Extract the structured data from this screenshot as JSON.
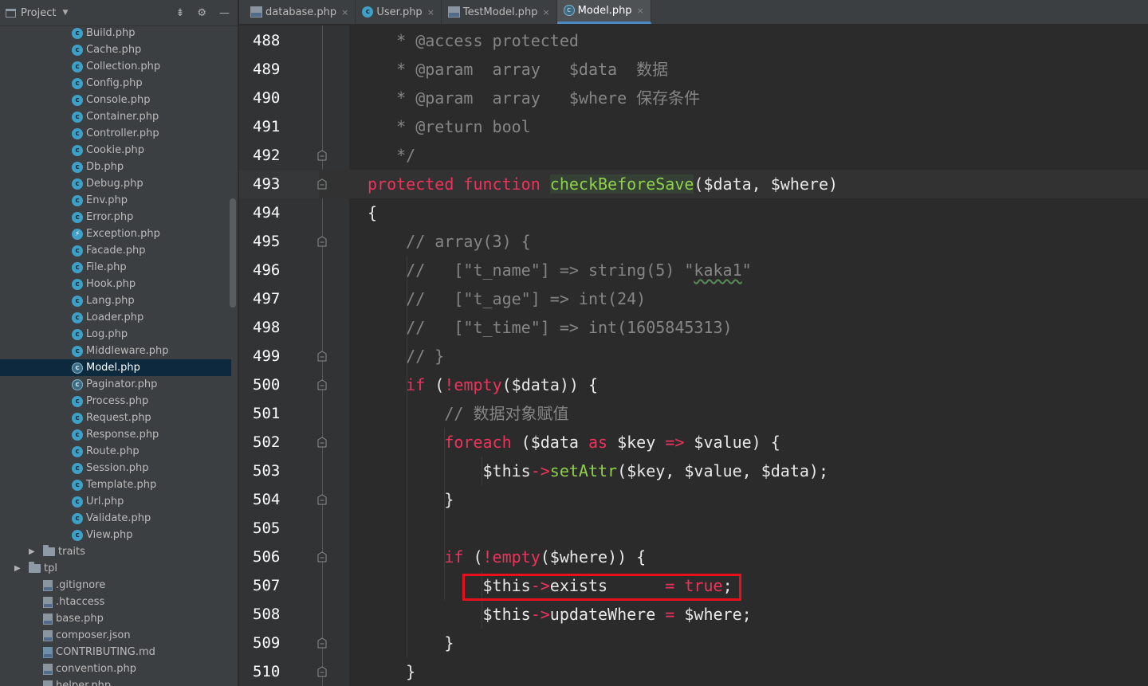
{
  "sidebar": {
    "title": "Project",
    "items": [
      {
        "label": "Build.php",
        "icon": "class-icon",
        "indent": 90
      },
      {
        "label": "Cache.php",
        "icon": "class-icon",
        "indent": 90
      },
      {
        "label": "Collection.php",
        "icon": "class-icon",
        "indent": 90
      },
      {
        "label": "Config.php",
        "icon": "class-icon",
        "indent": 90
      },
      {
        "label": "Console.php",
        "icon": "class-icon",
        "indent": 90
      },
      {
        "label": "Container.php",
        "icon": "class-icon",
        "indent": 90
      },
      {
        "label": "Controller.php",
        "icon": "class-icon",
        "indent": 90
      },
      {
        "label": "Cookie.php",
        "icon": "class-icon",
        "indent": 90
      },
      {
        "label": "Db.php",
        "icon": "class-icon",
        "indent": 90
      },
      {
        "label": "Debug.php",
        "icon": "class-icon",
        "indent": 90
      },
      {
        "label": "Env.php",
        "icon": "class-icon",
        "indent": 90
      },
      {
        "label": "Error.php",
        "icon": "class-icon",
        "indent": 90
      },
      {
        "label": "Exception.php",
        "icon": "exception-class-icon",
        "indent": 90
      },
      {
        "label": "Facade.php",
        "icon": "class-icon",
        "indent": 90
      },
      {
        "label": "File.php",
        "icon": "class-icon",
        "indent": 90
      },
      {
        "label": "Hook.php",
        "icon": "class-icon",
        "indent": 90
      },
      {
        "label": "Lang.php",
        "icon": "class-icon",
        "indent": 90
      },
      {
        "label": "Loader.php",
        "icon": "class-icon",
        "indent": 90
      },
      {
        "label": "Log.php",
        "icon": "class-icon",
        "indent": 90
      },
      {
        "label": "Middleware.php",
        "icon": "class-icon",
        "indent": 90
      },
      {
        "label": "Model.php",
        "icon": "abstract-class-icon",
        "indent": 90,
        "selected": true
      },
      {
        "label": "Paginator.php",
        "icon": "abstract-class-icon",
        "indent": 90
      },
      {
        "label": "Process.php",
        "icon": "class-icon",
        "indent": 90
      },
      {
        "label": "Request.php",
        "icon": "class-icon",
        "indent": 90
      },
      {
        "label": "Response.php",
        "icon": "class-icon",
        "indent": 90
      },
      {
        "label": "Route.php",
        "icon": "class-icon",
        "indent": 90
      },
      {
        "label": "Session.php",
        "icon": "class-icon",
        "indent": 90
      },
      {
        "label": "Template.php",
        "icon": "class-icon",
        "indent": 90
      },
      {
        "label": "Url.php",
        "icon": "class-icon",
        "indent": 90
      },
      {
        "label": "Validate.php",
        "icon": "class-icon",
        "indent": 90
      },
      {
        "label": "View.php",
        "icon": "class-icon",
        "indent": 90
      },
      {
        "label": "traits",
        "icon": "folder-icon",
        "indent": 54,
        "arrow": true
      },
      {
        "label": "tpl",
        "icon": "folder-icon",
        "indent": 36,
        "arrow": true
      },
      {
        "label": ".gitignore",
        "icon": "text-file-icon",
        "indent": 54
      },
      {
        "label": ".htaccess",
        "icon": "php-file-icon",
        "indent": 54
      },
      {
        "label": "base.php",
        "icon": "php-file-icon",
        "indent": 54
      },
      {
        "label": "composer.json",
        "icon": "json-file-icon",
        "indent": 54
      },
      {
        "label": "CONTRIBUTING.md",
        "icon": "markdown-file-icon",
        "indent": 54
      },
      {
        "label": "convention.php",
        "icon": "php-file-icon",
        "indent": 54
      },
      {
        "label": "helper.php",
        "icon": "php-file-icon",
        "indent": 54
      }
    ]
  },
  "tabs": [
    {
      "label": "database.php",
      "icon": "php-file-icon"
    },
    {
      "label": "User.php",
      "icon": "class-icon"
    },
    {
      "label": "TestModel.php",
      "icon": "php-file-icon"
    },
    {
      "label": "Model.php",
      "icon": "abstract-class-icon",
      "active": true
    }
  ],
  "tab_close_glyph": "×",
  "colors": {
    "keyword": "#f0325a",
    "function": "#8fd14b",
    "comment": "#858585",
    "highlight_box": "#e8101c",
    "selected_tree": "#0d293e"
  },
  "editor": {
    "current_line": 493,
    "lines": [
      {
        "n": "488",
        "fold": false,
        "tokens": [
          [
            "c",
            "   * @access protected"
          ]
        ]
      },
      {
        "n": "489",
        "fold": false,
        "tokens": [
          [
            "c",
            "   * @param  array   $data  数据"
          ]
        ]
      },
      {
        "n": "490",
        "fold": false,
        "tokens": [
          [
            "c",
            "   * @param  array   $where 保存条件"
          ]
        ]
      },
      {
        "n": "491",
        "fold": false,
        "tokens": [
          [
            "c",
            "   * @return bool"
          ]
        ]
      },
      {
        "n": "492",
        "fold": true,
        "tokens": [
          [
            "c",
            "   */"
          ]
        ]
      },
      {
        "n": "493",
        "fold": true,
        "tokens": [
          [
            "k",
            "protected"
          ],
          [
            "p",
            " "
          ],
          [
            "k",
            "function"
          ],
          [
            "p",
            " "
          ],
          [
            "fh",
            "checkBeforeSave"
          ],
          [
            "p",
            "($data, $where)"
          ]
        ]
      },
      {
        "n": "494",
        "fold": false,
        "tokens": [
          [
            "p",
            "{"
          ]
        ]
      },
      {
        "n": "495",
        "fold": true,
        "tokens": [
          [
            "c",
            "    // array(3) {"
          ]
        ]
      },
      {
        "n": "496",
        "fold": false,
        "tokens": [
          [
            "c",
            "    //   [\"t_name\"] => string(5) \""
          ],
          [
            "ct",
            "kaka1"
          ],
          [
            "c",
            "\""
          ]
        ]
      },
      {
        "n": "497",
        "fold": false,
        "tokens": [
          [
            "c",
            "    //   [\"t_age\"] => int(24)"
          ]
        ]
      },
      {
        "n": "498",
        "fold": false,
        "tokens": [
          [
            "c",
            "    //   [\"t_time\"] => int(1605845313)"
          ]
        ]
      },
      {
        "n": "499",
        "fold": true,
        "tokens": [
          [
            "c",
            "    // }"
          ]
        ]
      },
      {
        "n": "500",
        "fold": true,
        "tokens": [
          [
            "p",
            "    "
          ],
          [
            "k",
            "if"
          ],
          [
            "p",
            " ("
          ],
          [
            "k",
            "!empty"
          ],
          [
            "p",
            "($data)) {"
          ]
        ]
      },
      {
        "n": "501",
        "fold": false,
        "tokens": [
          [
            "c",
            "        // 数据对象赋值"
          ]
        ]
      },
      {
        "n": "502",
        "fold": true,
        "tokens": [
          [
            "p",
            "        "
          ],
          [
            "k",
            "foreach"
          ],
          [
            "p",
            " ($data "
          ],
          [
            "k",
            "as"
          ],
          [
            "p",
            " $key "
          ],
          [
            "k",
            "=>"
          ],
          [
            "p",
            " $value) {"
          ]
        ]
      },
      {
        "n": "503",
        "fold": false,
        "tokens": [
          [
            "p",
            "            $this"
          ],
          [
            "k",
            "->"
          ],
          [
            "f",
            "setAttr"
          ],
          [
            "p",
            "($key, $value, $data);"
          ]
        ]
      },
      {
        "n": "504",
        "fold": true,
        "tokens": [
          [
            "p",
            "        }"
          ]
        ]
      },
      {
        "n": "505",
        "fold": false,
        "tokens": [
          [
            "p",
            ""
          ]
        ]
      },
      {
        "n": "506",
        "fold": true,
        "tokens": [
          [
            "p",
            "        "
          ],
          [
            "k",
            "if"
          ],
          [
            "p",
            " ("
          ],
          [
            "k",
            "!empty"
          ],
          [
            "p",
            "($where)) {"
          ]
        ]
      },
      {
        "n": "507",
        "fold": false,
        "tokens": [
          [
            "p",
            "            $this"
          ],
          [
            "k",
            "->"
          ],
          [
            "p",
            "exists      "
          ],
          [
            "k",
            "="
          ],
          [
            "p",
            " "
          ],
          [
            "k",
            "true"
          ],
          [
            "p",
            ";"
          ]
        ]
      },
      {
        "n": "508",
        "fold": false,
        "tokens": [
          [
            "p",
            "            $this"
          ],
          [
            "k",
            "->"
          ],
          [
            "p",
            "updateWhere "
          ],
          [
            "k",
            "="
          ],
          [
            "p",
            " $where;"
          ]
        ]
      },
      {
        "n": "509",
        "fold": true,
        "tokens": [
          [
            "p",
            "        }"
          ]
        ]
      },
      {
        "n": "510",
        "fold": true,
        "tokens": [
          [
            "p",
            "    }"
          ]
        ]
      }
    ]
  }
}
